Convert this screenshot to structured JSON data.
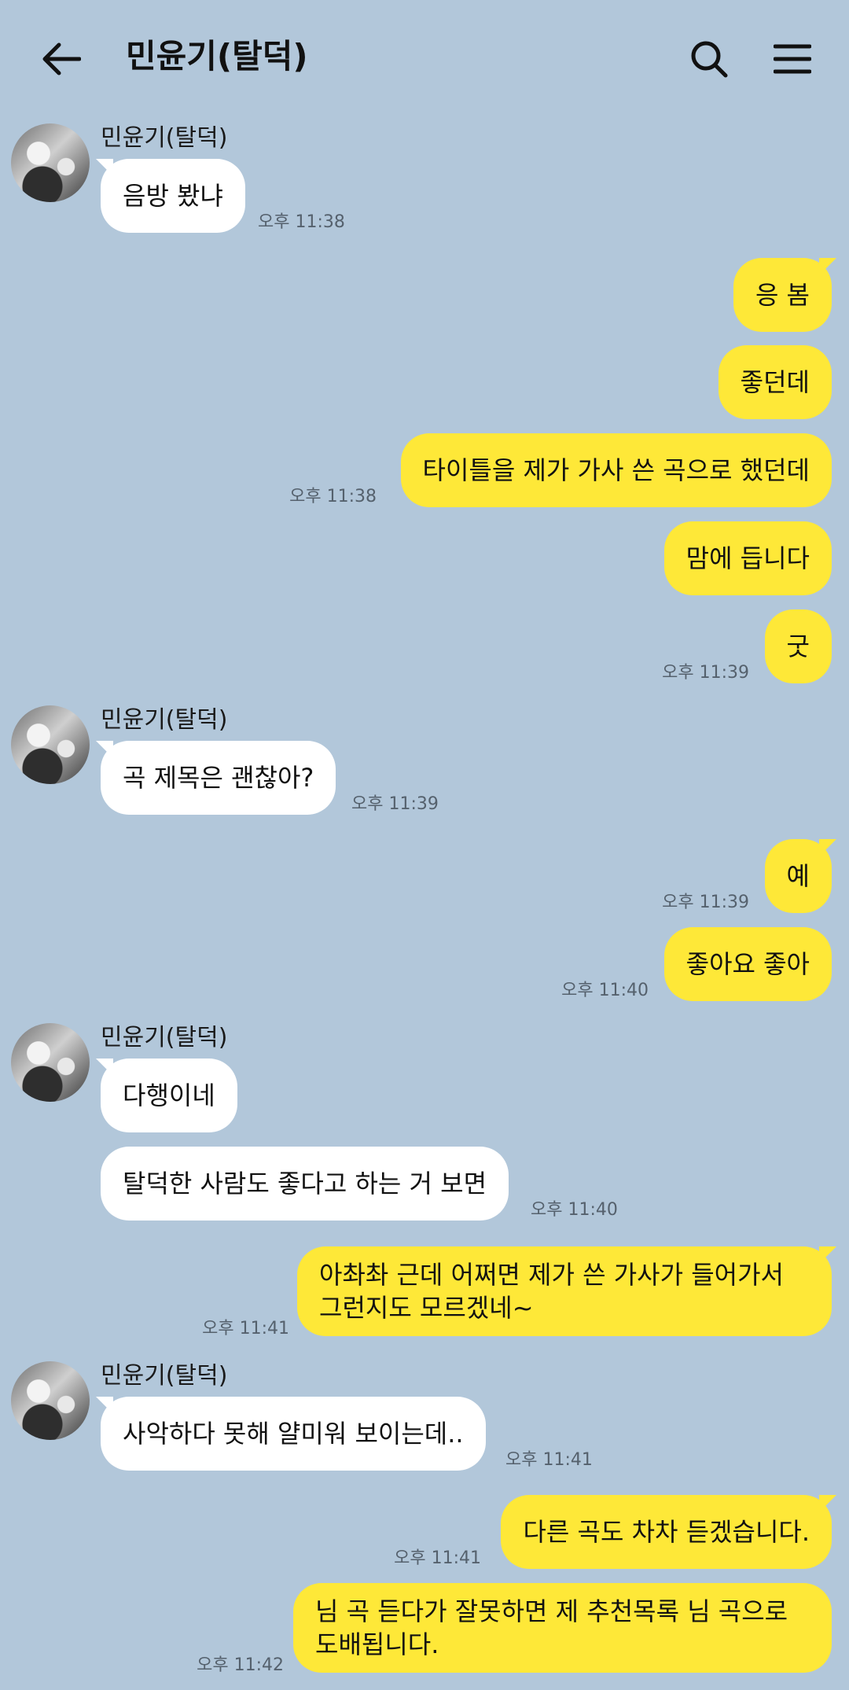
{
  "header": {
    "title": "민윤기(탈덕)"
  },
  "icons": {
    "back": "arrow-left-icon",
    "search": "search-icon",
    "menu": "hamburger-menu-icon"
  },
  "colors": {
    "background": "#b2c7da",
    "sent_bubble": "#fee838",
    "received_bubble": "#ffffff"
  },
  "messages": {
    "g1": {
      "sender": "민윤기(탈덕)",
      "m1": "음방 봤냐",
      "time": "오후 11:38"
    },
    "s1": {
      "m1": "응 봄",
      "m2": "좋던데",
      "m3": "타이틀을 제가 가사 쓴 곡으로 했던데",
      "time3": "오후 11:38",
      "m4": "맘에 듭니다",
      "m5": "굿",
      "time5": "오후 11:39"
    },
    "g2": {
      "sender": "민윤기(탈덕)",
      "m1": "곡 제목은 괜찮아?",
      "time": "오후 11:39"
    },
    "s2": {
      "m1": "예",
      "time1": "오후 11:39",
      "m2": "좋아요 좋아",
      "time2": "오후 11:40"
    },
    "g3": {
      "sender": "민윤기(탈덕)",
      "m1": "다행이네",
      "m2": "탈덕한 사람도 좋다고 하는 거 보면",
      "time": "오후 11:40"
    },
    "s3": {
      "m1": "아촤촤 근데 어쩌면 제가 쓴 가사가 들어가서 그런지도 모르겠네~",
      "time": "오후 11:41"
    },
    "g4": {
      "sender": "민윤기(탈덕)",
      "m1": "사악하다 못해 얄미워 보이는데..",
      "time": "오후 11:41"
    },
    "s4": {
      "m1": "다른 곡도 차차 듣겠습니다.",
      "time1": "오후 11:41",
      "m2": "님 곡 듣다가 잘못하면 제 추천목록 님 곡으로 도배됩니다.",
      "time2": "오후 11:42"
    }
  }
}
